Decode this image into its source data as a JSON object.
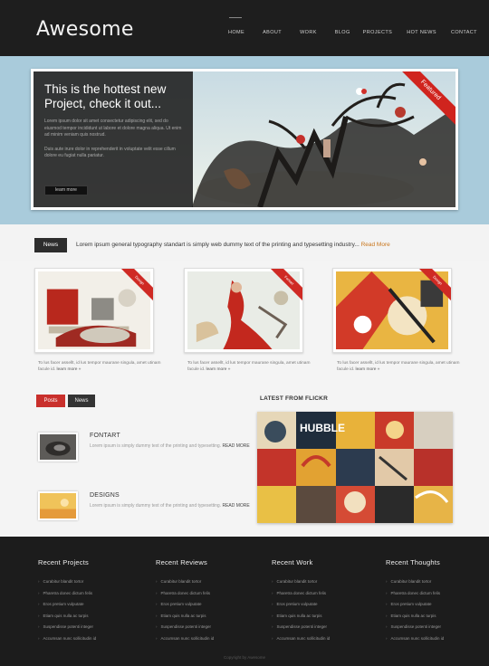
{
  "header": {
    "logo": "Awesome",
    "nav": [
      "HOME",
      "ABOUT",
      "WORK",
      "BLOG",
      "PROJECTS",
      "HOT NEWS",
      "CONTACT"
    ]
  },
  "hero": {
    "title": "This is the hottest new Project, check it out...",
    "text_1": "Lorem ipsum dolor sit amet consectetur adipiscing elit, sed do eiusmod tempor incididunt ut labore et dolore magna aliqua. Ut enim ad minim veniam quis nostrud.",
    "text_2": "Duis aute irure dolor in reprehenderit in voluptate velit esse cillum dolore eu fugiat nulla pariatur.",
    "button": "learn more",
    "ribbon": "Featured"
  },
  "news": {
    "label": "News",
    "text": "Lorem ipsum general typography standart is simply web dummy text of the printing and typesetting industry...",
    "more": "Read More"
  },
  "projects": [
    {
      "ribbon": "Design",
      "text": "To lus facer assellt, id lus tempor maurane singula, amet utinam facule id.",
      "more": "learn more »"
    },
    {
      "ribbon": "Fontart",
      "text": "To lus facer assellt, id lus tempor maurane singula, amet utinam facule id.",
      "more": "learn more »"
    },
    {
      "ribbon": "Design",
      "text": "To lus facer assellt, id lus tempor maurane singula, amet utinam facule id.",
      "more": "learn more »"
    }
  ],
  "tabs": {
    "posts": "Posts",
    "news": "News"
  },
  "posts": [
    {
      "title": "FONTART",
      "text": "Lorem ipsum is simply dummy text of the printing and typesetting.",
      "more": "READ MORE"
    },
    {
      "title": "DESIGNS",
      "text": "Lorem ipsum is simply dummy text of the printing and typesetting.",
      "more": "READ MORE"
    }
  ],
  "flickr": {
    "title": "LATEST FROM FLICKR",
    "word": "HUBBLE"
  },
  "footer": {
    "columns": [
      {
        "title": "Recent Projects",
        "items": [
          "Curabitur blandit tortor",
          "Pharetra donec dictum felis",
          "Eros pretium vulputate",
          "Etiam quis nulla ac turpis",
          "Suspendisse potenti integer",
          "Accumsan nunc sollicitudin id"
        ]
      },
      {
        "title": "Recent Reviews",
        "items": [
          "Curabitur blandit tortor",
          "Pharetra donec dictum felis",
          "Eros pretium vulputate",
          "Etiam quis nulla ac turpis",
          "Suspendisse potenti integer",
          "Accumsan nunc sollicitudin id"
        ]
      },
      {
        "title": "Recent Work",
        "items": [
          "Curabitur blandit tortor",
          "Pharetra donec dictum felis",
          "Eros pretium vulputate",
          "Etiam quis nulla ac turpis",
          "Suspendisse potenti integer",
          "Accumsan nunc sollicitudin id"
        ]
      },
      {
        "title": "Recent Thoughts",
        "items": [
          "Curabitur blandit tortor",
          "Pharetra donec dictum felis",
          "Eros pretium vulputate",
          "Etiam quis nulla ac turpis",
          "Suspendisse potenti integer",
          "Accumsan nunc sollicitudin id"
        ]
      }
    ],
    "copyright": "Copyright by Awesome"
  },
  "colors": {
    "accent": "#c9302c",
    "link": "#c9761c",
    "dark": "#1e1e1e",
    "sky": "#a9cbdb"
  }
}
